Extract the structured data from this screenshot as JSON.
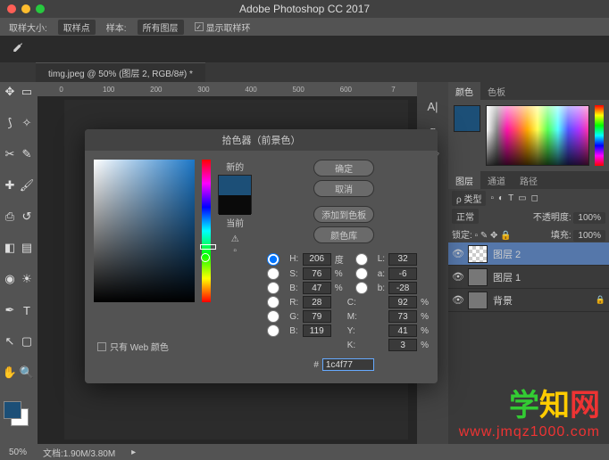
{
  "app": {
    "title": "Adobe Photoshop CC 2017"
  },
  "optbar": {
    "sample_size_label": "取样大小:",
    "sample_size_value": "取样点",
    "sample_label": "样本:",
    "sample_value": "所有图层",
    "show_ring_label": "显示取样环"
  },
  "doc_tab": "timg.jpeg @ 50% (图层 2, RGB/8#) *",
  "ruler_marks": [
    "0",
    "100",
    "200",
    "300",
    "400",
    "500",
    "600",
    "7"
  ],
  "panels": {
    "color_tab": "颜色",
    "swatches_tab": "色板",
    "layers_tab": "图层",
    "channels_tab": "通道",
    "paths_tab": "路径",
    "kind_label": "ρ 类型",
    "blend_mode": "正常",
    "opacity_label": "不透明度:",
    "opacity_value": "100%",
    "lock_label": "锁定:",
    "fill_label": "填充:",
    "fill_value": "100%",
    "layers": [
      {
        "name": "图层 2",
        "visible": true,
        "selected": true,
        "checker": true
      },
      {
        "name": "图层 1",
        "visible": true,
        "selected": false,
        "checker": false
      },
      {
        "name": "背景",
        "visible": true,
        "selected": false,
        "checker": false,
        "locked": true
      }
    ]
  },
  "dialog": {
    "title": "拾色器（前景色）",
    "new_label": "新的",
    "current_label": "当前",
    "ok": "确定",
    "cancel": "取消",
    "add_swatch": "添加到色板",
    "libraries": "颜色库",
    "web_only": "只有 Web 颜色",
    "H_label": "H:",
    "H": "206",
    "H_unit": "度",
    "S_label": "S:",
    "S": "76",
    "S_unit": "%",
    "Bb_label": "B:",
    "Bb": "47",
    "Bb_unit": "%",
    "R_label": "R:",
    "R": "28",
    "G_label": "G:",
    "G": "79",
    "B_label": "B:",
    "B": "119",
    "L_label": "L:",
    "L": "32",
    "a_label": "a:",
    "a": "-6",
    "b2_label": "b:",
    "b2": "-28",
    "Cc_label": "C:",
    "Cc": "92",
    "Cc_unit": "%",
    "M_label": "M:",
    "M": "73",
    "M_unit": "%",
    "Y_label": "Y:",
    "Y": "41",
    "Y_unit": "%",
    "K_label": "K:",
    "K": "3",
    "K_unit": "%",
    "hex_label": "#",
    "hex": "1c4f77"
  },
  "status": {
    "zoom": "50%",
    "docsize": "文档:1.90M/3.80M"
  },
  "watermark": {
    "chars": [
      "学",
      "知",
      "网"
    ],
    "url": "www.jmqz1000.com"
  }
}
